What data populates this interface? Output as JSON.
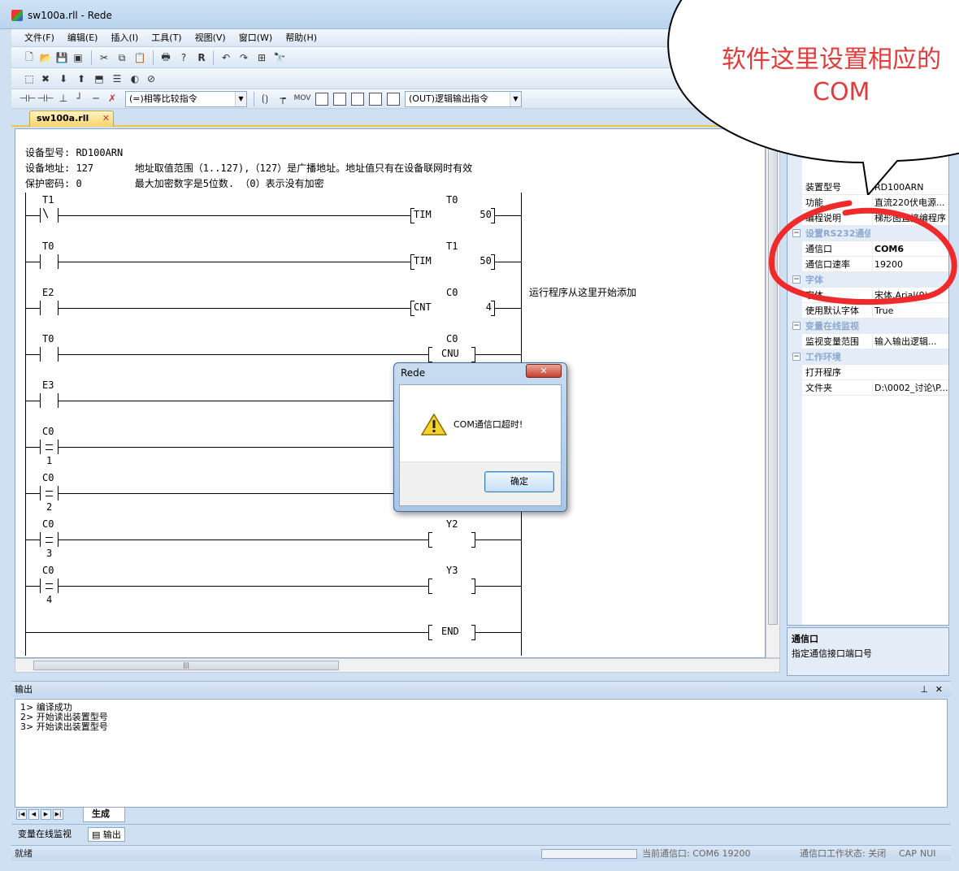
{
  "window": {
    "title": "sw100a.rll - Rede"
  },
  "menu": [
    "文件(F)",
    "编辑(E)",
    "插入(I)",
    "工具(T)",
    "视图(V)",
    "窗口(W)",
    "帮助(H)"
  ],
  "toolbar": {
    "compare_combo": "(=)相等比较指令",
    "output_combo": "(OUT)逻辑输出指令",
    "mov_label": "MOV",
    "r_label": "R"
  },
  "doc_tab": {
    "label": "sw100a.rll"
  },
  "editor": {
    "header": [
      "设备型号: RD100ARN",
      "设备地址: 127       地址取值范围（1..127),（127）是广播地址。地址值只有在设备联网时有效",
      "保护密码: 0         最大加密数字是5位数. （0）表示没有加密"
    ],
    "annotation": "运行程序从这里开始添加",
    "rungs": [
      {
        "contact": "T1",
        "coil_top": "T0",
        "coil_type": "TIM",
        "coil_value": "50"
      },
      {
        "contact": "T0",
        "coil_top": "T1",
        "coil_type": "TIM",
        "coil_value": "50"
      },
      {
        "contact": "E2",
        "coil_top": "C0",
        "coil_type": "CNT",
        "coil_value": "4"
      },
      {
        "contact": "T0",
        "coil_top": "C0",
        "coil_type": "CNU",
        "coil_value": ""
      },
      {
        "contact": "E3",
        "coil_top": "",
        "coil_type": "",
        "coil_value": ""
      },
      {
        "contact": "C0",
        "contact_sub": "1",
        "coil_top": "",
        "coil_type": "",
        "coil_value": ""
      },
      {
        "contact": "C0",
        "contact_sub": "2",
        "coil_top": "",
        "coil_type": "",
        "coil_value": ""
      },
      {
        "contact": "C0",
        "contact_sub": "3",
        "coil_top": "Y2",
        "coil_type": "",
        "coil_value": ""
      },
      {
        "contact": "C0",
        "contact_sub": "4",
        "coil_top": "Y3",
        "coil_type": "",
        "coil_value": ""
      }
    ],
    "end_label": "END"
  },
  "properties": {
    "rows": [
      {
        "key": "装置型号",
        "value": "RD100ARN",
        "cat": false
      },
      {
        "key": "功能",
        "value": "直流220伏电源...",
        "cat": false
      },
      {
        "key": "编程说明",
        "value": "梯形图直接编程序",
        "cat": false
      },
      {
        "key": "设置RS232通信口",
        "value": "",
        "cat": true
      },
      {
        "key": "通信口",
        "value": "COM6",
        "cat": false,
        "bold": true
      },
      {
        "key": "通信口速率",
        "value": "19200",
        "cat": false
      },
      {
        "key": "字体",
        "value": "",
        "cat": true
      },
      {
        "key": "字体",
        "value": "宋体,Arial(9)",
        "cat": false
      },
      {
        "key": "使用默认字体",
        "value": "True",
        "cat": false
      },
      {
        "key": "变量在线监视",
        "value": "",
        "cat": true
      },
      {
        "key": "监视变量范围",
        "value": "输入输出逻辑...",
        "cat": false
      },
      {
        "key": "工作环境",
        "value": "",
        "cat": true
      },
      {
        "key": "打开程序",
        "value": "",
        "cat": false
      },
      {
        "key": "文件夹",
        "value": "D:\\0002_讨论\\P...",
        "cat": false
      }
    ],
    "desc_title": "通信口",
    "desc_text": "指定通信接口端口号"
  },
  "output": {
    "title": "输出",
    "lines": [
      "1> 编译成功",
      "2> 开始读出装置型号",
      "3> 开始读出装置型号"
    ],
    "tab": "生成"
  },
  "bottom_tabs": [
    "变量在线监视",
    "输出"
  ],
  "status": {
    "ready": "就绪",
    "port": "当前通信口: COM6 19200",
    "port_state": "通信口工作状态: 关闭",
    "cap": "CAP",
    "num": "NUI"
  },
  "dialog": {
    "title": "Rede",
    "close": "✕",
    "message": "COM通信口超时!",
    "ok": "确定"
  },
  "callout": {
    "line1": "软件这里设置相应的",
    "line2": "COM"
  }
}
